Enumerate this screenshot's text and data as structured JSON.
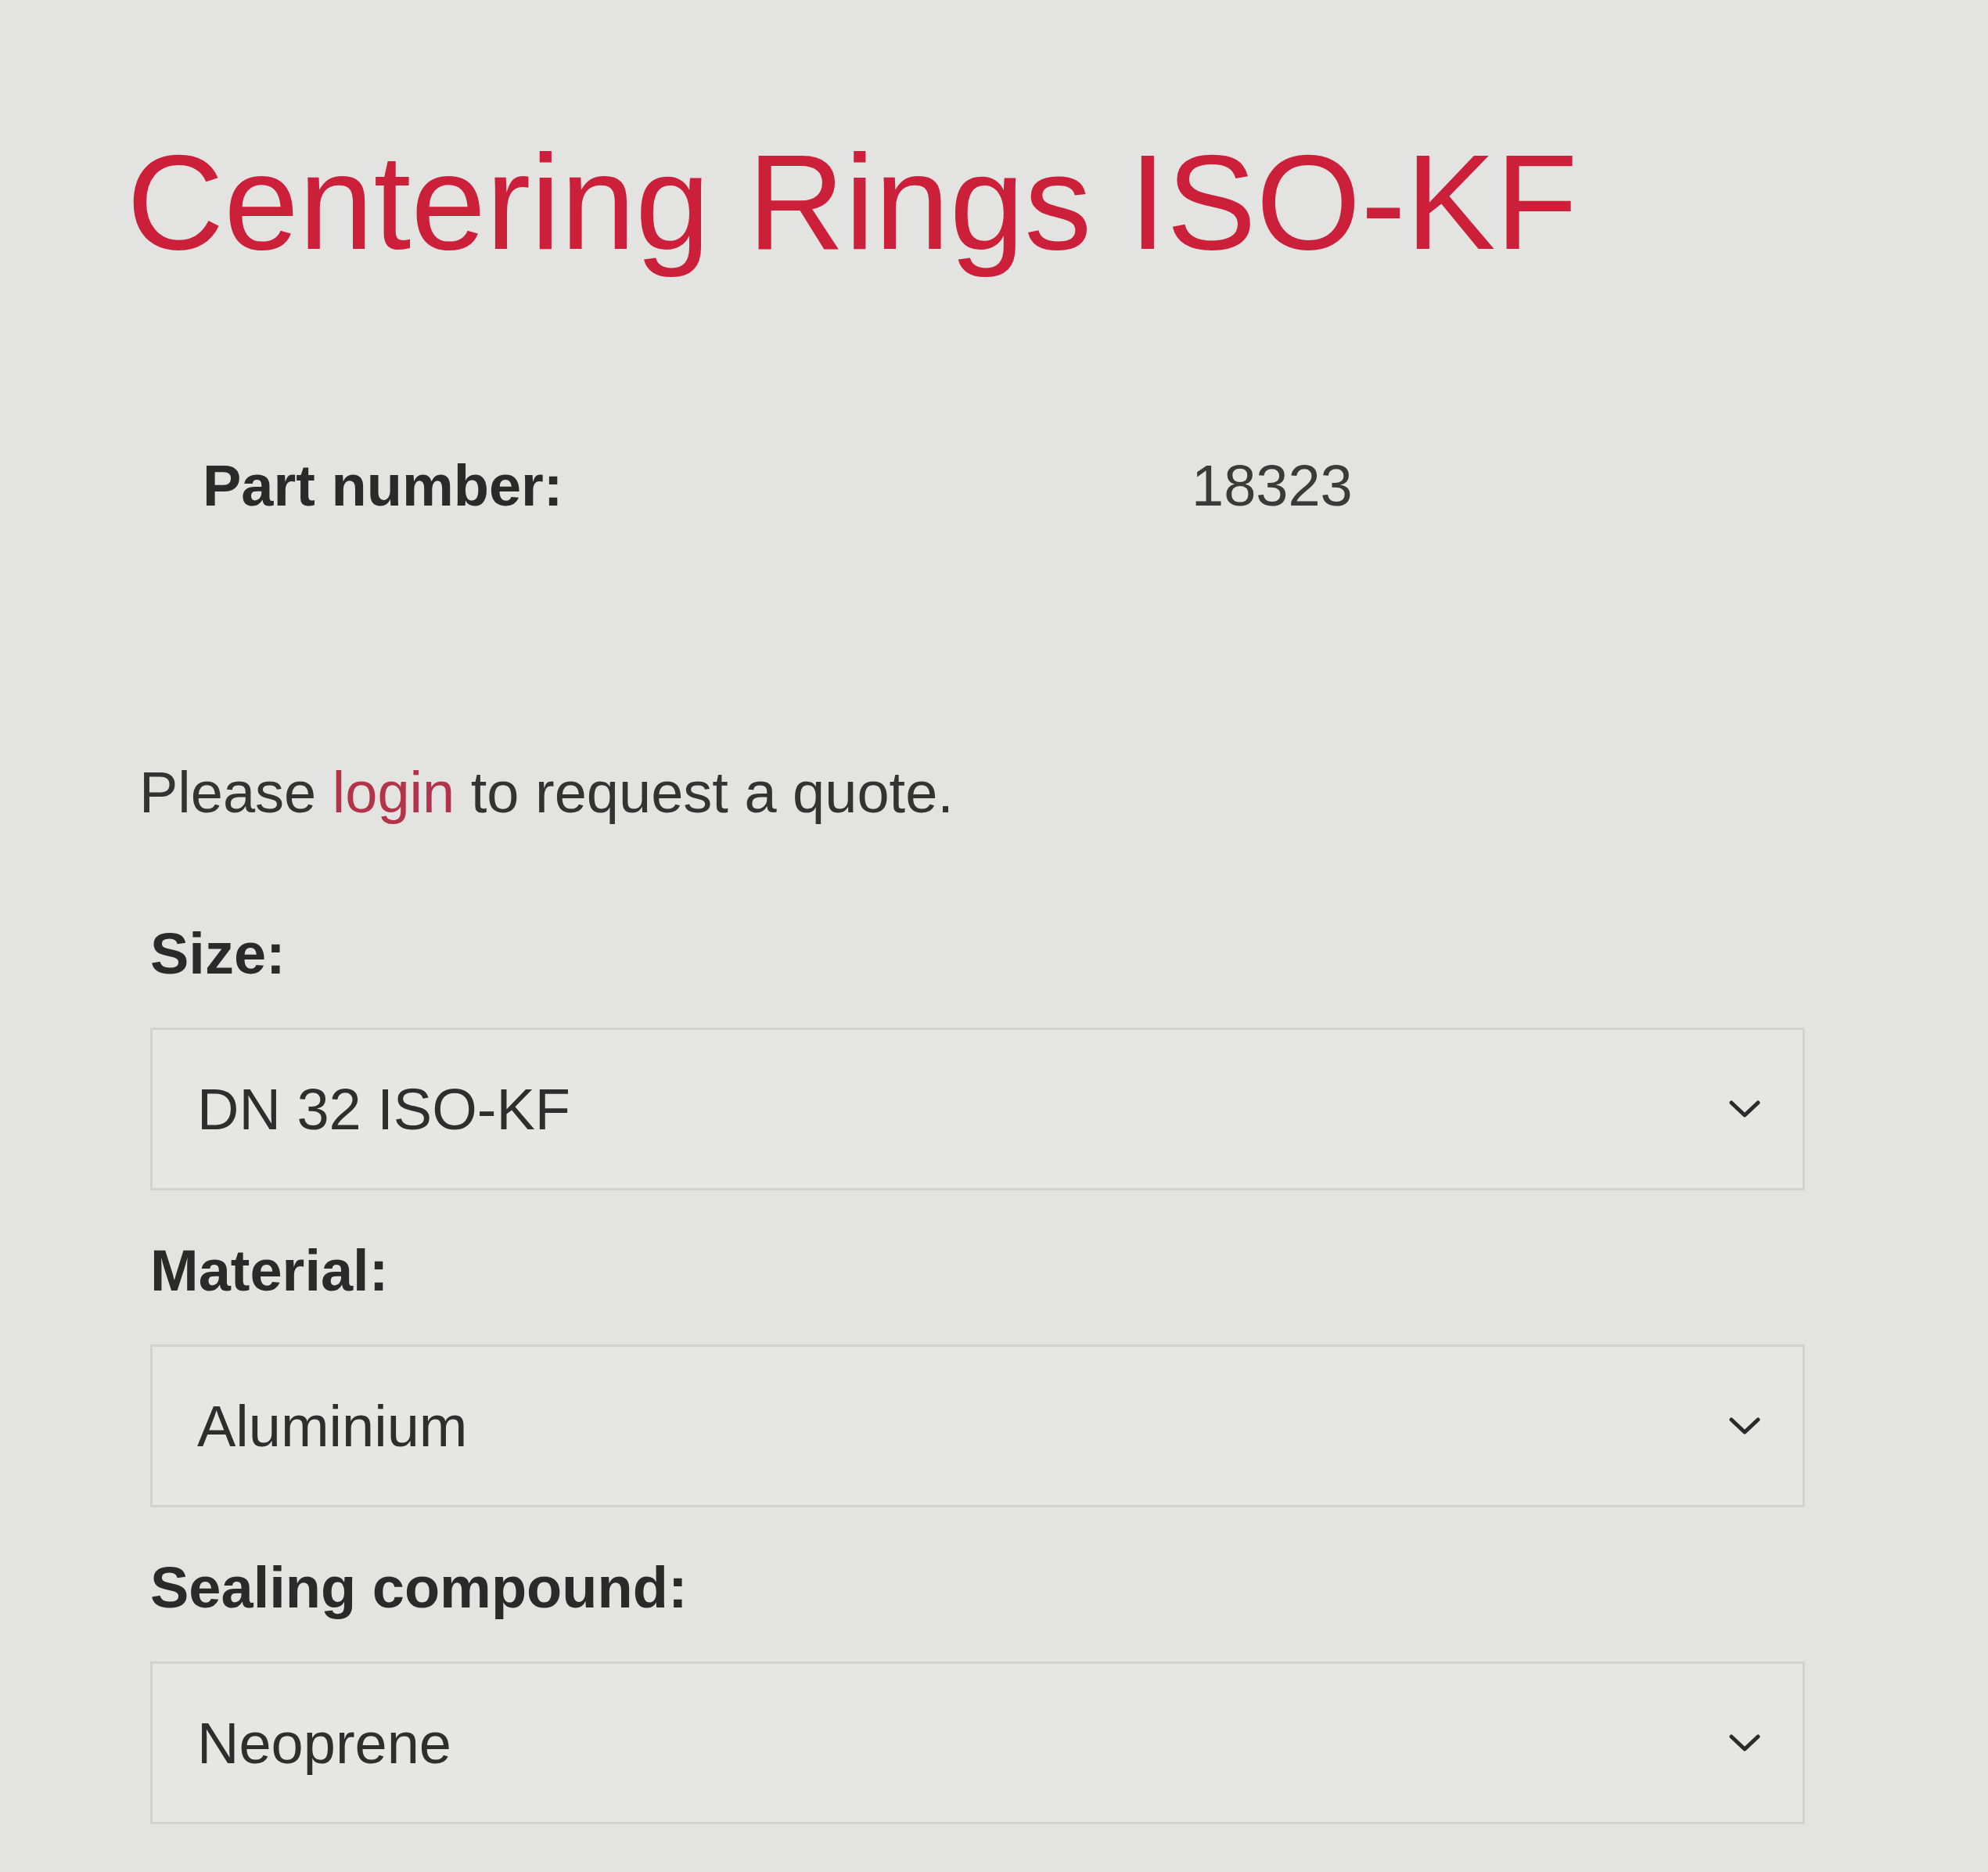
{
  "title": "Centering Rings ISO-KF",
  "part_number": {
    "label": "Part number:",
    "value": "18323"
  },
  "quote_notice": {
    "before": "Please",
    "link": "login",
    "after": "to request a quote."
  },
  "fields": [
    {
      "label": "Size:",
      "value": "DN 32 ISO-KF"
    },
    {
      "label": "Material:",
      "value": "Aluminium"
    },
    {
      "label": "Sealing compound:",
      "value": "Neoprene"
    }
  ]
}
